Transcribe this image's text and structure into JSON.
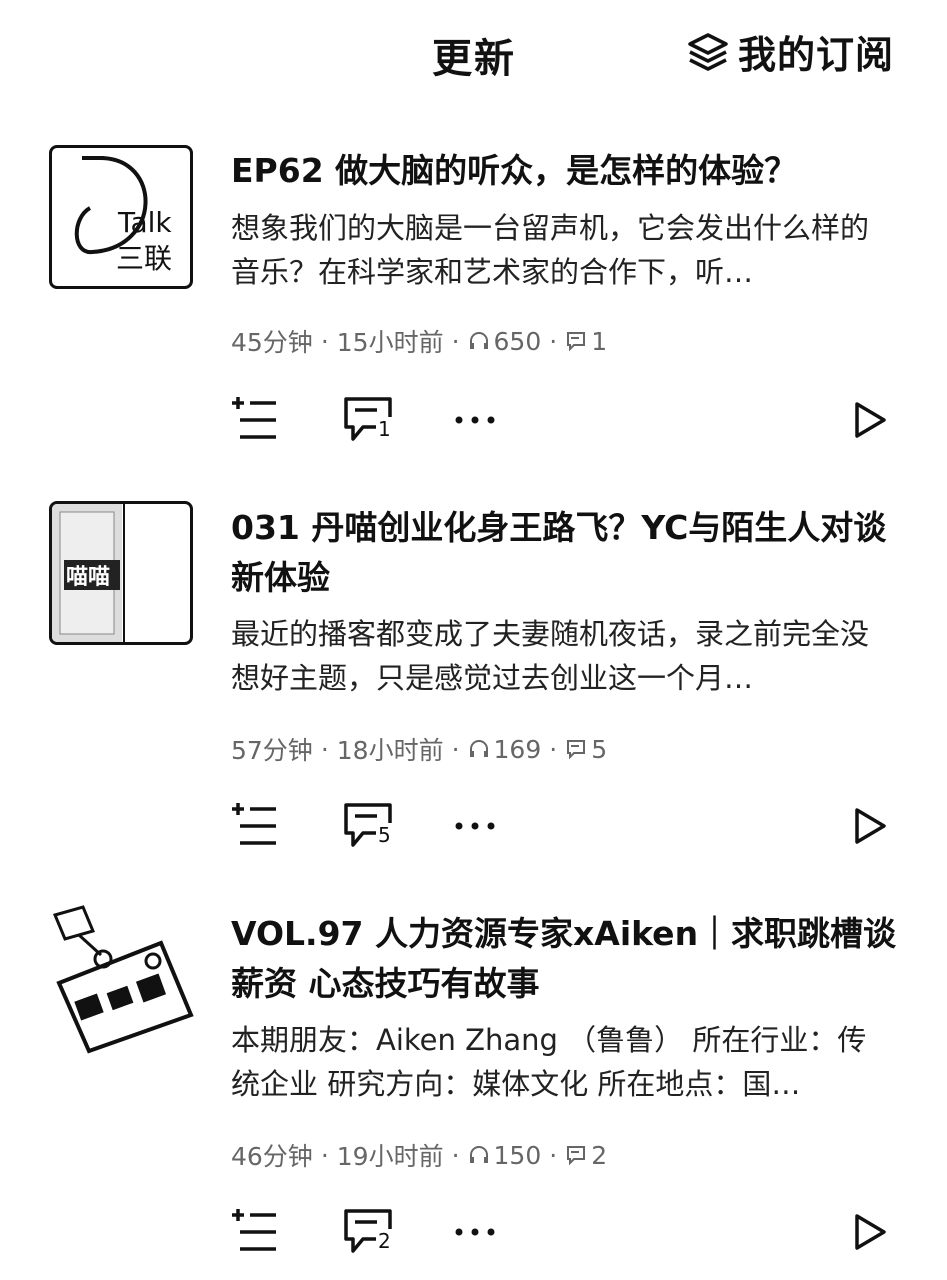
{
  "header": {
    "title": "更新",
    "subscriptions_label": "我的订阅"
  },
  "episodes": [
    {
      "cover": {
        "line1": "Talk",
        "line2": "三联"
      },
      "title": "EP62 做大脑的听众，是怎样的体验？",
      "description": "想象我们的大脑是一台留声机，它会发出什么样的音乐？在科学家和艺术家的合作下，听…",
      "duration": "45分钟",
      "published": "15小时前",
      "plays": "650",
      "comments": "1"
    },
    {
      "cover": {
        "line1": "喵喵",
        "line2": ""
      },
      "title": "031 丹喵创业化身王路飞？YC与陌生人对谈新体验",
      "description": "最近的播客都变成了夫妻随机夜话，录之前完全没想好主题，只是感觉过去创业这一个月…",
      "duration": "57分钟",
      "published": "18小时前",
      "plays": "169",
      "comments": "5"
    },
    {
      "cover": {
        "line1": "",
        "line2": ""
      },
      "title": "VOL.97 人力资源专家xAiken｜求职跳槽谈薪资 心态技巧有故事",
      "description": "本期朋友：Aiken Zhang （鲁鲁） 所在行业：传统企业 研究方向：媒体文化 所在地点：国…",
      "duration": "46分钟",
      "published": "19小时前",
      "plays": "150",
      "comments": "2"
    }
  ]
}
